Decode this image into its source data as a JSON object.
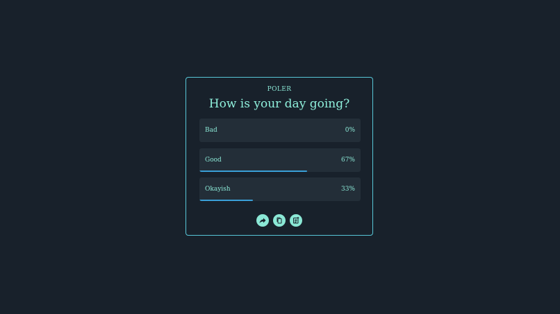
{
  "poll": {
    "brand": "POLER",
    "question": "How is your day going?",
    "options": [
      {
        "label": "Bad",
        "percent_text": "0%",
        "percent": 0
      },
      {
        "label": "Good",
        "percent_text": "67%",
        "percent": 67
      },
      {
        "label": "Okayish",
        "percent_text": "33%",
        "percent": 33
      }
    ]
  },
  "actions": [
    {
      "icon": "share-icon"
    },
    {
      "icon": "copy-icon"
    },
    {
      "icon": "new-poll-icon"
    }
  ],
  "colors": {
    "background": "#18212b",
    "accent": "#8be8d6",
    "border": "#58c7d8",
    "bar": "#3aa0d8",
    "option_bg": "#232e38"
  }
}
